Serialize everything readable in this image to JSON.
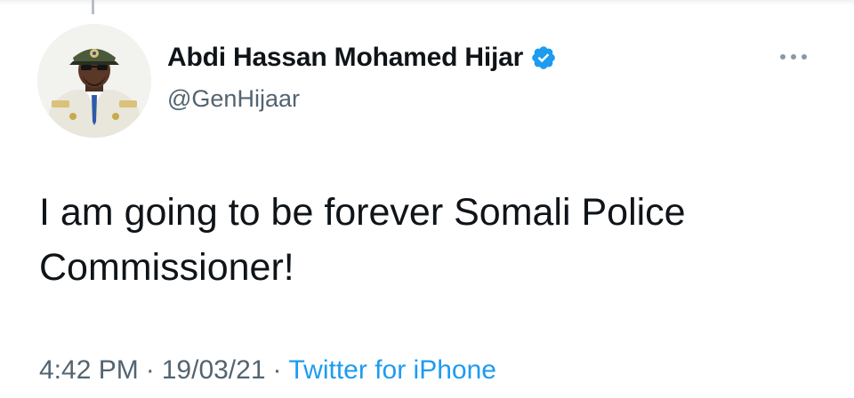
{
  "tweet": {
    "author": {
      "display_name": "Abdi Hassan Mohamed Hijar",
      "handle": "@GenHijaar",
      "verified": true,
      "avatar_icon": "avatar-photo",
      "verified_icon": "verified-badge-icon"
    },
    "more_icon": "more-options-icon",
    "text_line_1": "I am going to be forever Somali Police",
    "text_line_2": "Commissioner!",
    "time": "4:42 PM",
    "date": "19/03/21",
    "separator": "·",
    "source": "Twitter for iPhone"
  },
  "colors": {
    "text": "#0f1419",
    "muted": "#536471",
    "accent": "#1d9bf0"
  }
}
